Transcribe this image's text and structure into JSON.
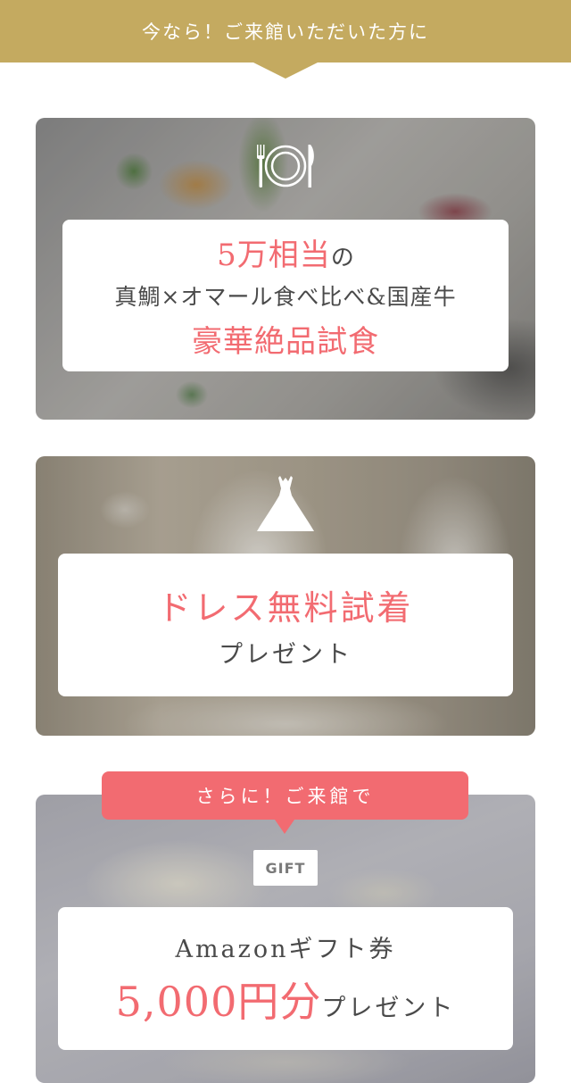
{
  "banner": {
    "text": "今なら！ご来館いただいた方に",
    "color": "#c4aa60"
  },
  "cards": {
    "tasting": {
      "icon": "cutlery-plate-icon",
      "amount": "5万相当",
      "particle": "の",
      "description": "真鯛×オマール食べ比べ&国産牛",
      "headline": "豪華絶品試食"
    },
    "dress": {
      "icon": "wedding-dress-icon",
      "headline": "ドレス無料試着",
      "sub": "プレゼント"
    },
    "gift": {
      "bubble": "さらに！ご来館で",
      "icon_label": "GIFT",
      "title": "Amazonギフト券",
      "amount": "5,000円分",
      "sub": "プレゼント"
    }
  },
  "colors": {
    "accent": "#f26b71",
    "gold": "#c4aa60",
    "text": "#4a4a4a"
  }
}
